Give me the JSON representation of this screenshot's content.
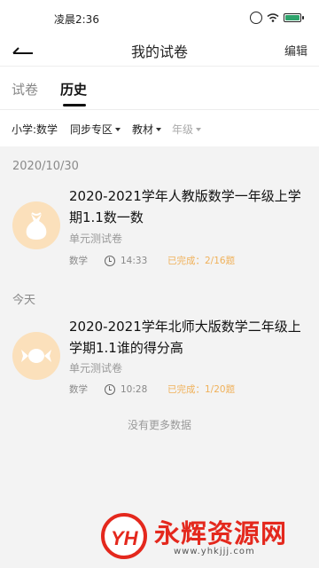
{
  "status_bar": {
    "time": "凌晨2:36"
  },
  "header": {
    "title": "我的试卷",
    "edit_label": "编辑"
  },
  "tabs": [
    {
      "label": "试卷",
      "active": false
    },
    {
      "label": "历史",
      "active": true
    }
  ],
  "filters": [
    {
      "label": "小学:数学",
      "has_caret": false,
      "enabled": true
    },
    {
      "label": "同步专区",
      "has_caret": true,
      "enabled": true
    },
    {
      "label": "教材",
      "has_caret": true,
      "enabled": true
    },
    {
      "label": "年级",
      "has_caret": true,
      "enabled": false
    }
  ],
  "groups": [
    {
      "date_label": "2020/10/30",
      "item": {
        "title": "2020-2021学年人教版数学一年级上学期1.1数一数",
        "type": "单元测试卷",
        "subject": "数学",
        "time": "14:33",
        "progress": "已完成：2/16题",
        "icon": "money-bag-icon"
      }
    },
    {
      "date_label": "今天",
      "item": {
        "title": "2020-2021学年北师大版数学二年级上学期1.1谁的得分高",
        "type": "单元测试卷",
        "subject": "数学",
        "time": "10:28",
        "progress": "已完成：1/20题",
        "icon": "candy-icon"
      }
    }
  ],
  "footer_text": "没有更多数据",
  "watermark": {
    "logo": "YH",
    "text": "永辉资源网",
    "url": "www.yhkjjj.com"
  },
  "colors": {
    "progress": "#f0b15a",
    "avatar_bg": "#fbe0bb",
    "watermark": "#e4281d"
  }
}
